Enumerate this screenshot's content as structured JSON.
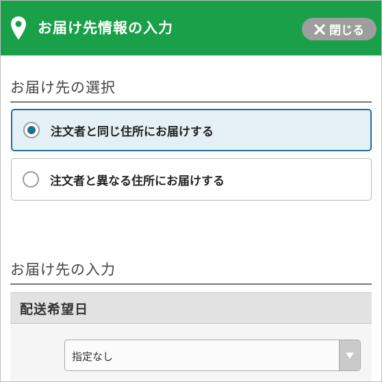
{
  "header": {
    "title": "お届け先情報の入力",
    "close_label": "閉じる",
    "background_color": "#1aa048"
  },
  "destination_select": {
    "heading": "お届け先の選択",
    "options": [
      {
        "label": "注文者と同じ住所にお届けする",
        "selected": true
      },
      {
        "label": "注文者と異なる住所にお届けする",
        "selected": false
      }
    ]
  },
  "destination_input": {
    "heading": "お届け先の入力",
    "delivery_date": {
      "label": "配送希望日",
      "selected_value": "指定なし"
    }
  },
  "icons": {
    "header_icon": "map-pin-icon",
    "close_icon": "close-icon",
    "select_icon": "chevron-down-icon"
  },
  "colors": {
    "accent": "#1d6f91",
    "selected_bg": "#e4eff6",
    "close_button_bg": "#9e9e9e"
  }
}
